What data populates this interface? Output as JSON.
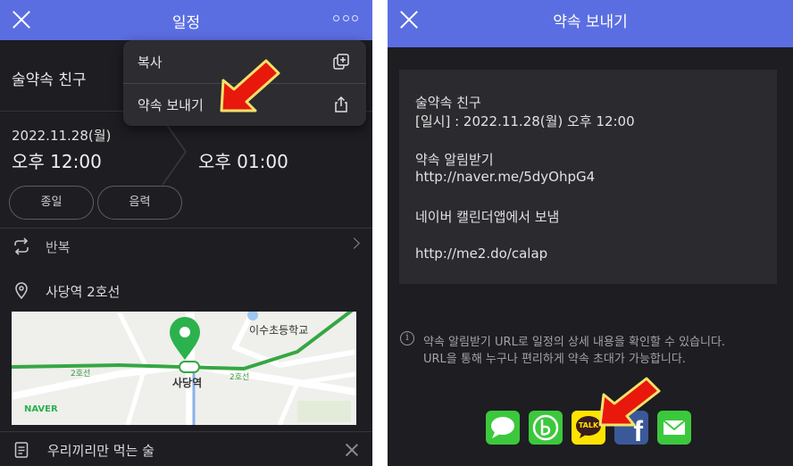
{
  "left": {
    "header_title": "일정",
    "event_title": "술약속 친구",
    "start_date": "2022.11.28(월)",
    "start_time": "오후 12:00",
    "end_time": "오후 01:00",
    "pill_all_day": "종일",
    "pill_lunar": "음력",
    "repeat_label": "반복",
    "location_label": "사당역 2호선",
    "memo_text": "우리끼리만 먹는 술",
    "popup": {
      "copy_label": "복사",
      "send_label": "약속 보내기"
    },
    "map": {
      "school_label": "이수초등학교",
      "station_label": "사당역",
      "line_label": "2호선",
      "brand": "NAVER"
    }
  },
  "right": {
    "header_title": "약속 보내기",
    "message_lines": [
      "술약속 친구",
      "[일시] : 2022.11.28(월) 오후 12:00",
      "약속 알림받기",
      "http://naver.me/5dyOhpG4",
      "네이버 캘린더앱에서 보냄",
      "http://me2.do/calap"
    ],
    "info_lines": [
      "약속 알림받기 URL로 일정의 상세 내용을 확인할 수 있습니다.",
      "URL을 통해 누구나 편리하게 약속 초대가 가능합니다."
    ],
    "share_buttons": [
      {
        "icon": "message-icon",
        "color": "#3cc83c"
      },
      {
        "icon": "band-icon",
        "color": "#3cc83c"
      },
      {
        "icon": "kakaotalk-icon",
        "color": "#ffe300",
        "label": "TALK"
      },
      {
        "icon": "facebook-icon",
        "color": "#3b5998",
        "label": "f"
      },
      {
        "icon": "mail-icon",
        "color": "#3cc83c"
      }
    ]
  },
  "colors": {
    "header": "#5b6ee1",
    "background": "#1d1d22",
    "accent_green": "#2bb24c",
    "annotation_red": "#e8180c"
  }
}
